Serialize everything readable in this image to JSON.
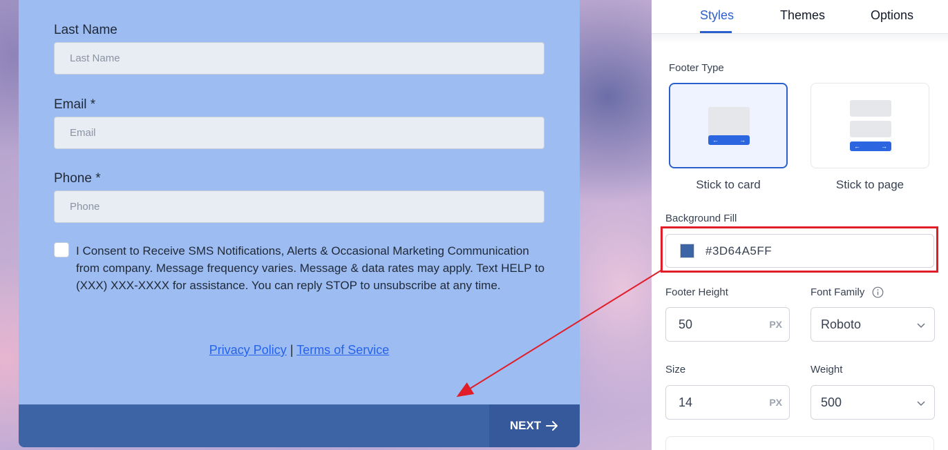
{
  "form": {
    "last_name": {
      "label": "Last Name",
      "placeholder": "Last Name"
    },
    "email": {
      "label": "Email *",
      "placeholder": "Email"
    },
    "phone": {
      "label": "Phone *",
      "placeholder": "Phone"
    },
    "consent_text": "I Consent to Receive SMS Notifications, Alerts & Occasional Marketing Communication from company. Message frequency varies. Message & data rates may apply. Text HELP to (XXX) XXX-XXXX for assistance. You can reply STOP to unsubscribe at any time.",
    "privacy_link": "Privacy Policy",
    "separator": "|",
    "terms_link": "Terms of Service",
    "next_label": "NEXT",
    "footer_color": "#3D64A5"
  },
  "panel": {
    "tabs": [
      {
        "label": "Styles",
        "active": true
      },
      {
        "label": "Themes",
        "active": false
      },
      {
        "label": "Options",
        "active": false
      }
    ],
    "footer_type": {
      "label": "Footer Type",
      "options": [
        {
          "caption": "Stick to card",
          "selected": true
        },
        {
          "caption": "Stick to page",
          "selected": false
        }
      ]
    },
    "background_fill": {
      "label": "Background Fill",
      "value": "#3D64A5FF"
    },
    "footer_height": {
      "label": "Footer Height",
      "value": "50",
      "unit": "PX"
    },
    "font_family": {
      "label": "Font Family",
      "value": "Roboto"
    },
    "size": {
      "label": "Size",
      "value": "14",
      "unit": "PX"
    },
    "weight": {
      "label": "Weight",
      "value": "500"
    }
  },
  "colors": {
    "accent": "#2B5FCC",
    "annotation": "#E11D2A"
  }
}
